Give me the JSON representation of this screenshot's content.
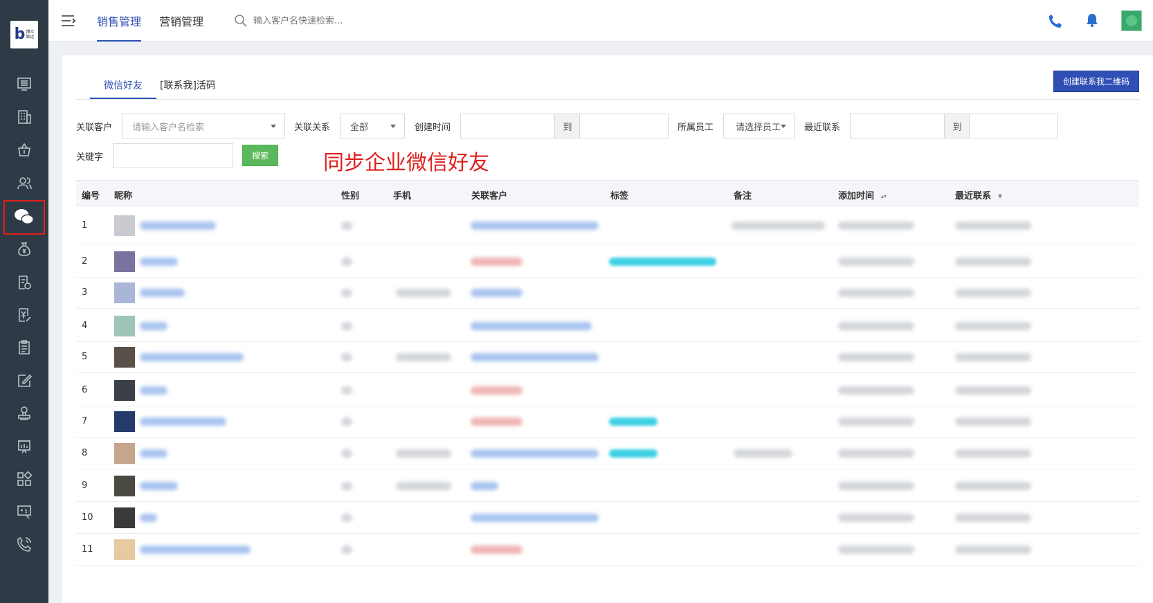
{
  "app": {
    "logo_letter": "b",
    "logo_text_line1": "博众",
    "logo_text_line2": "致远"
  },
  "header": {
    "tabs": [
      {
        "label": "销售管理",
        "active": true
      },
      {
        "label": "营销管理",
        "active": false
      }
    ],
    "search_placeholder": "输入客户名快速检索..."
  },
  "page": {
    "tabs": [
      {
        "label": "微信好友",
        "active": true
      },
      {
        "label": "[联系我]活码",
        "active": false
      }
    ],
    "create_button": "创建联系我二维码"
  },
  "filters": {
    "customer_label": "关联客户",
    "customer_placeholder": "请输入客户名检索",
    "relation_label": "关联关系",
    "relation_value": "全部",
    "created_label": "创建时间",
    "to_label": "到",
    "staff_label": "所属员工",
    "staff_placeholder": "请选择员工",
    "recent_label": "最近联系",
    "keyword_label": "关键字",
    "search_button": "搜索"
  },
  "annotation": "同步企业微信好友",
  "table": {
    "columns": [
      "编号",
      "昵称",
      "性别",
      "手机",
      "关联客户",
      "标签",
      "备注",
      "添加时间",
      "最近联系"
    ],
    "rows": [
      {
        "no": "1"
      },
      {
        "no": "2"
      },
      {
        "no": "3"
      },
      {
        "no": "4"
      },
      {
        "no": "5"
      },
      {
        "no": "6"
      },
      {
        "no": "7"
      },
      {
        "no": "8"
      },
      {
        "no": "9"
      },
      {
        "no": "10"
      },
      {
        "no": "11"
      }
    ]
  },
  "colors": {
    "sidebar": "#2f3a47",
    "accent": "#2a4fb0",
    "primary_button": "#2f4fb5",
    "search_button": "#5cb85c",
    "annotation": "#e0201c"
  },
  "icons": {
    "sidebar": [
      "monitor-icon",
      "building-icon",
      "basket-icon",
      "users-icon",
      "wechat-icon",
      "money-bag-icon",
      "document-settings-icon",
      "invoice-icon",
      "clipboard-icon",
      "edit-icon",
      "stamp-icon",
      "chart-board-icon",
      "apps-grid-icon",
      "calculator-screen-icon",
      "phone-call-icon"
    ],
    "header": [
      "menu-toggle-icon",
      "search-icon",
      "phone-icon",
      "bell-icon"
    ]
  }
}
